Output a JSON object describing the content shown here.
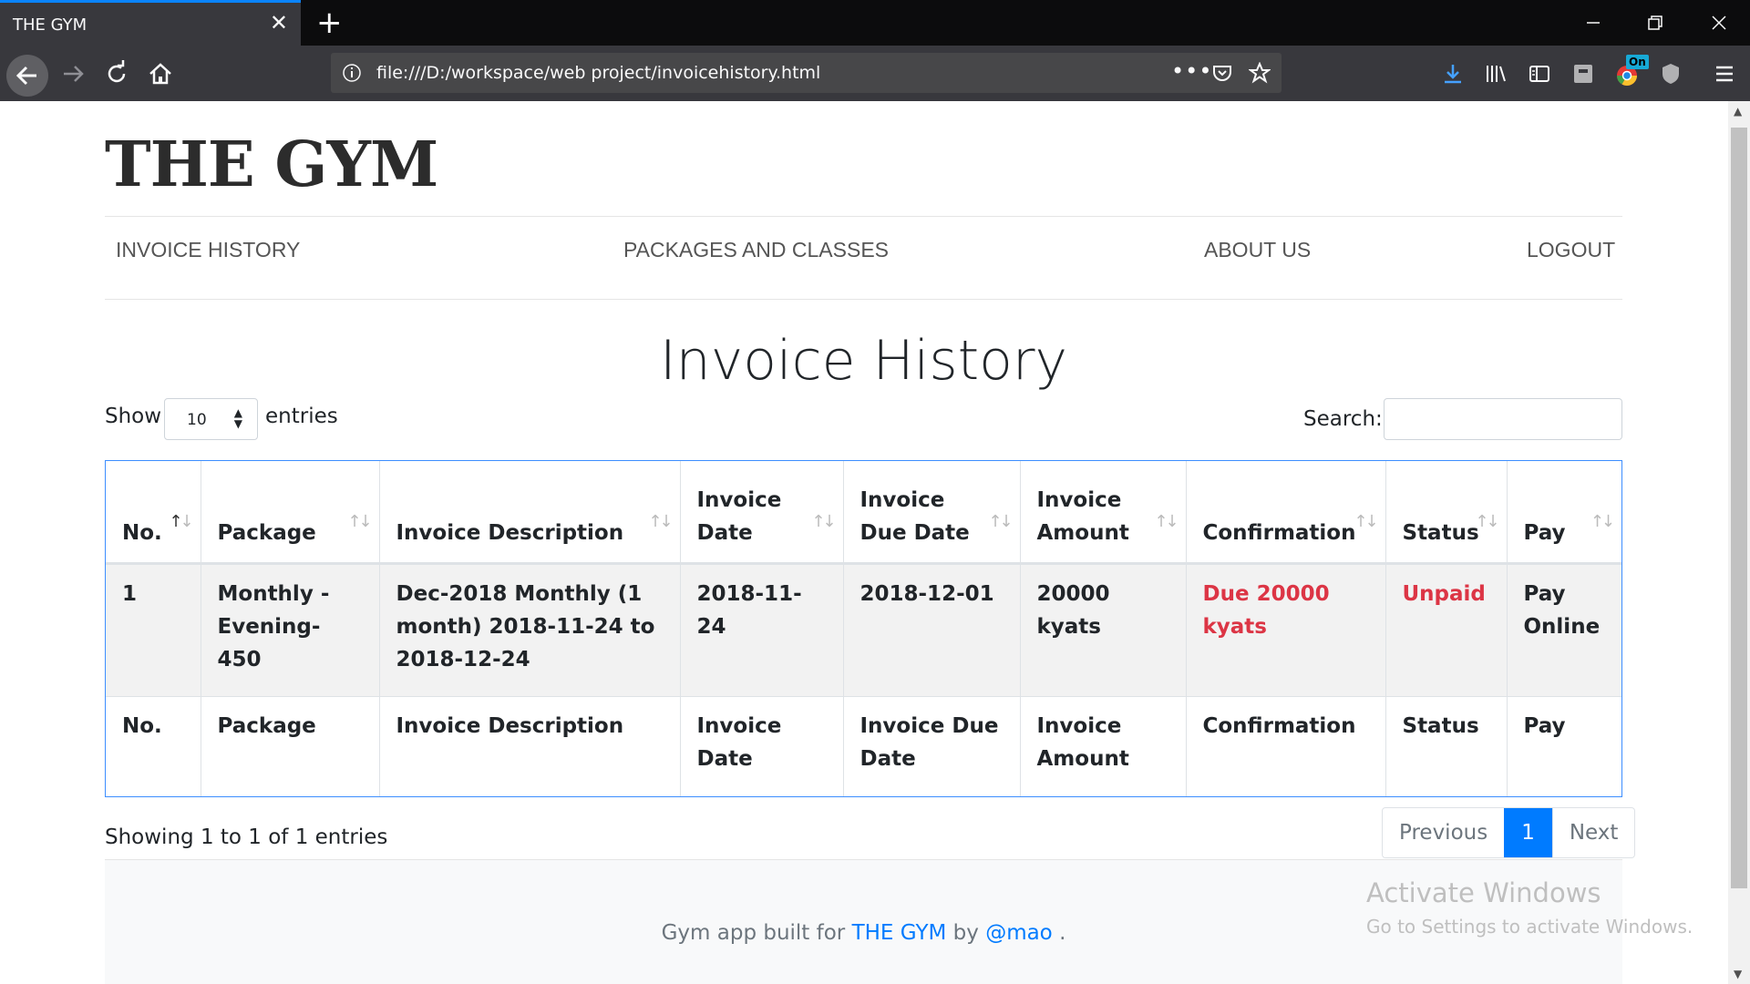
{
  "browser": {
    "tab_title": "THE GYM",
    "url": "file:///D:/workspace/web project/invoicehistory.html",
    "ext_badge": "On"
  },
  "site": {
    "brand": "THE GYM",
    "nav": [
      {
        "label": "INVOICE HISTORY"
      },
      {
        "label": "PACKAGES AND CLASSES"
      },
      {
        "label": "ABOUT US"
      },
      {
        "label": "LOGOUT"
      }
    ]
  },
  "main": {
    "heading": "Invoice History",
    "show_label": "Show",
    "length_value": "10",
    "entries_label": "entries",
    "search_label": "Search:",
    "search_value": ""
  },
  "table": {
    "headers": [
      "No.",
      "Package",
      "Invoice Description",
      "Invoice Date",
      "Invoice Due Date",
      "Invoice Amount",
      "Confirmation",
      "Status",
      "Pay"
    ],
    "rows": [
      {
        "no": "1",
        "package": "Monthly -Evening- 450",
        "description": "Dec-2018 Monthly (1 month) 2018-11-24 to 2018-12-24",
        "date": "2018-11-24",
        "due_date": "2018-12-01",
        "amount": "20000 kyats",
        "confirmation": "Due 20000 kyats",
        "status": "Unpaid",
        "pay": "Pay Online"
      }
    ],
    "footers": [
      "No.",
      "Package",
      "Invoice Description",
      "Invoice Date",
      "Invoice Due Date",
      "Invoice Amount",
      "Confirmation",
      "Status",
      "Pay"
    ]
  },
  "pagination": {
    "info": "Showing 1 to 1 of 1 entries",
    "previous": "Previous",
    "current": "1",
    "next": "Next"
  },
  "footer": {
    "prefix": "Gym app built for",
    "link1": "THE GYM",
    "by": "by",
    "link2": "@mao",
    "suffix": "."
  },
  "watermark": {
    "line1": "Activate Windows",
    "line2": "Go to Settings to activate Windows."
  },
  "colors": {
    "accent": "#007bff",
    "danger": "#dc3545",
    "browser_dark": "#0c0c0d",
    "toolbar": "#38383d"
  }
}
